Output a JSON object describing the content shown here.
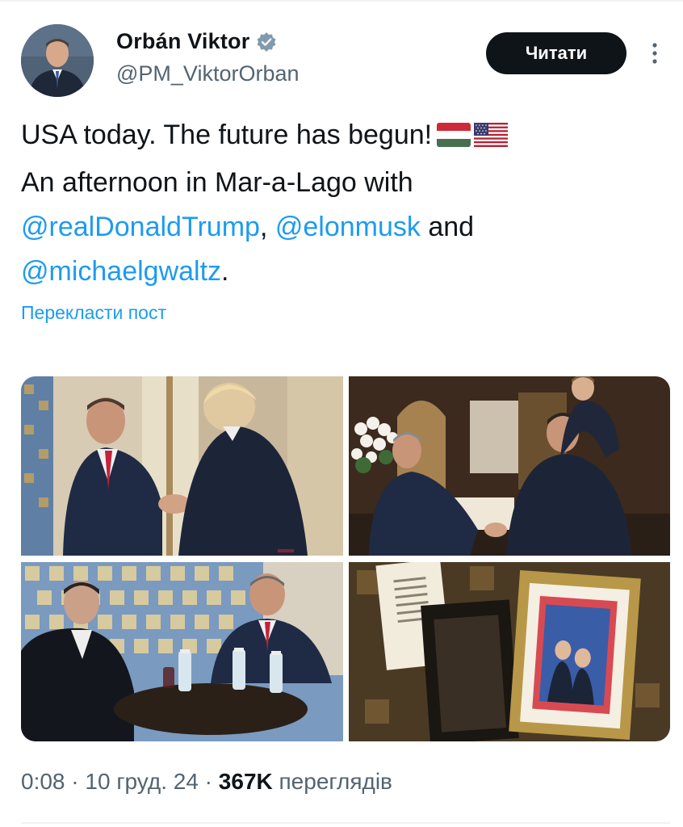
{
  "author": {
    "display_name": "Orbán Viktor",
    "handle": "@PM_ViktorOrban",
    "verified": true,
    "avatar_icon": "profile-photo-avatar"
  },
  "follow_button": {
    "label": "Читати"
  },
  "more_menu": {
    "icon": "vertical-ellipsis-icon"
  },
  "tweet": {
    "line1": "USA today. The future has begun!",
    "line2": "An afternoon in Mar-a-Lago with",
    "mentions": [
      "@realDonaldTrump",
      "@elonmusk",
      "@michaelgwaltz"
    ],
    "separator_comma": ",",
    "word_and": "and",
    "final_period": ".",
    "flags": [
      "hungary-flag-icon",
      "usa-flag-icon"
    ]
  },
  "translate": {
    "label": "Перекласти пост"
  },
  "media": [
    {
      "name": "photo-handshake-orban-trump"
    },
    {
      "name": "photo-handshake-interior"
    },
    {
      "name": "photo-meeting-at-table"
    },
    {
      "name": "photo-framed-pictures"
    }
  ],
  "meta": {
    "time": "0:08",
    "separator": " · ",
    "date": "10 груд. 24",
    "views_count": "367K",
    "views_label": "переглядів"
  },
  "colors": {
    "link": "#1d9bf0",
    "text": "#0f1419",
    "secondary": "#536471",
    "button_bg": "#0f1419"
  }
}
